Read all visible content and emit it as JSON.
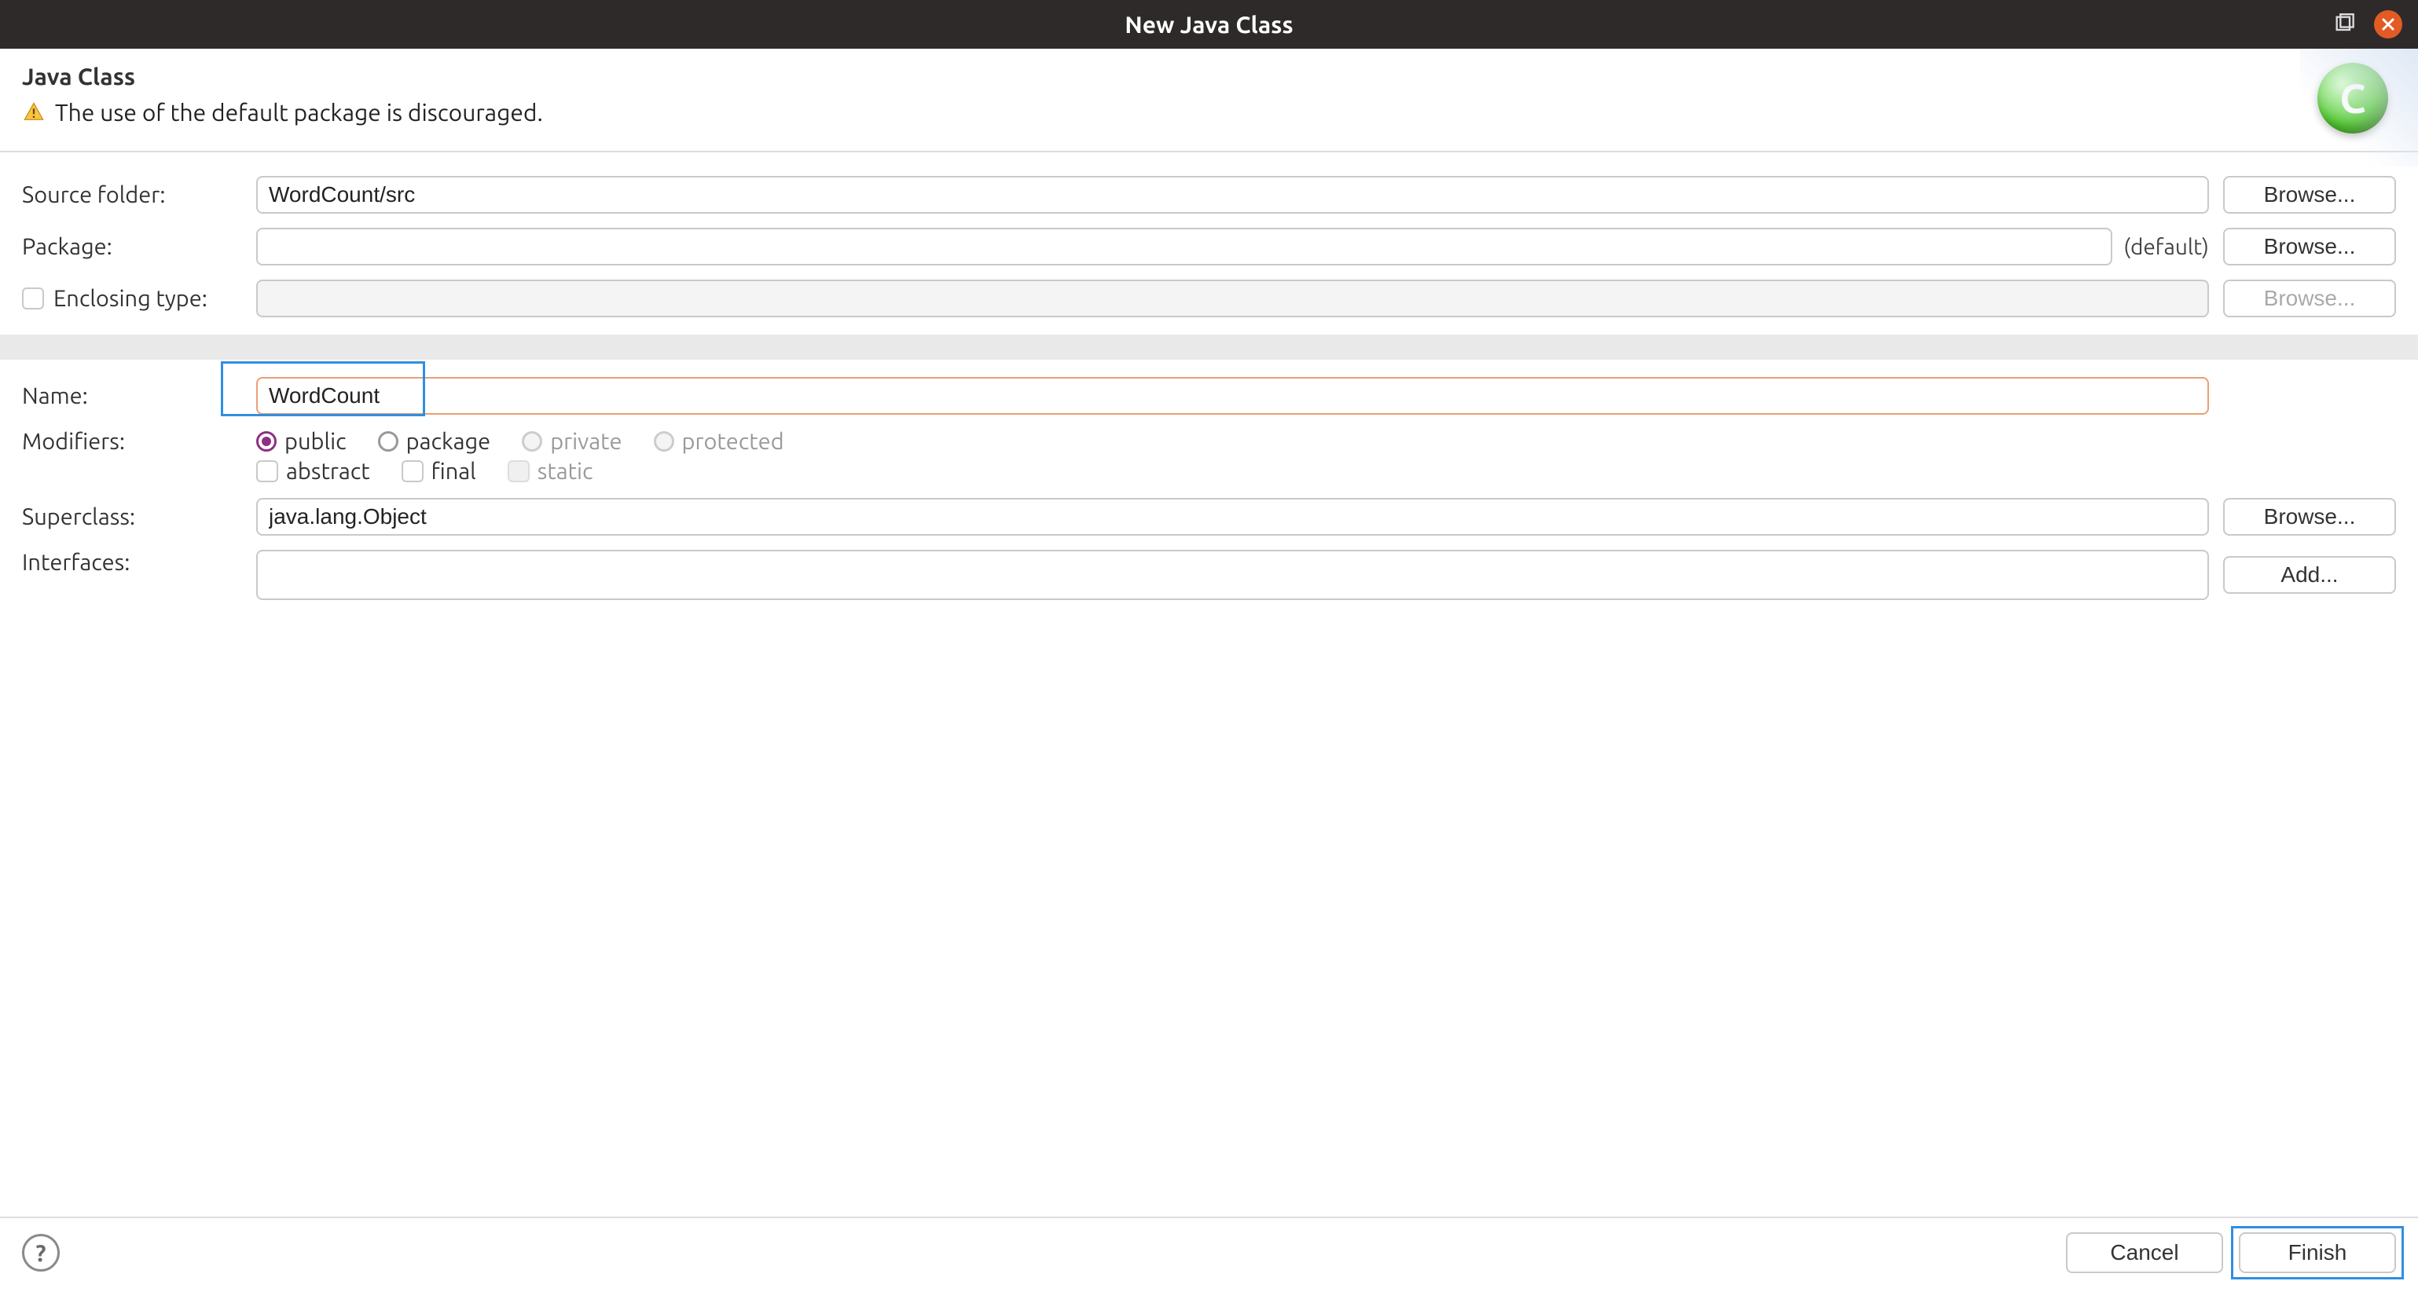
{
  "window": {
    "title": "New Java Class"
  },
  "header": {
    "heading": "Java Class",
    "warning": "The use of the default package is discouraged.",
    "badge_letter": "C"
  },
  "labels": {
    "source_folder": "Source folder:",
    "package": "Package:",
    "enclosing_type": "Enclosing type:",
    "name": "Name:",
    "modifiers": "Modifiers:",
    "superclass": "Superclass:",
    "interfaces": "Interfaces:"
  },
  "values": {
    "source_folder": "WordCount/src",
    "package": "",
    "package_hint": "(default)",
    "enclosing_type": "",
    "name": "WordCount",
    "superclass": "java.lang.Object"
  },
  "modifiers": {
    "access": [
      {
        "key": "public",
        "label": "public",
        "selected": true,
        "enabled": true
      },
      {
        "key": "package",
        "label": "package",
        "selected": false,
        "enabled": true
      },
      {
        "key": "private",
        "label": "private",
        "selected": false,
        "enabled": false
      },
      {
        "key": "protected",
        "label": "protected",
        "selected": false,
        "enabled": false
      }
    ],
    "flags": [
      {
        "key": "abstract",
        "label": "abstract",
        "checked": false,
        "enabled": true
      },
      {
        "key": "final",
        "label": "final",
        "checked": false,
        "enabled": true
      },
      {
        "key": "static",
        "label": "static",
        "checked": false,
        "enabled": false
      }
    ]
  },
  "buttons": {
    "browse": "Browse...",
    "add": "Add...",
    "cancel": "Cancel",
    "finish": "Finish"
  }
}
